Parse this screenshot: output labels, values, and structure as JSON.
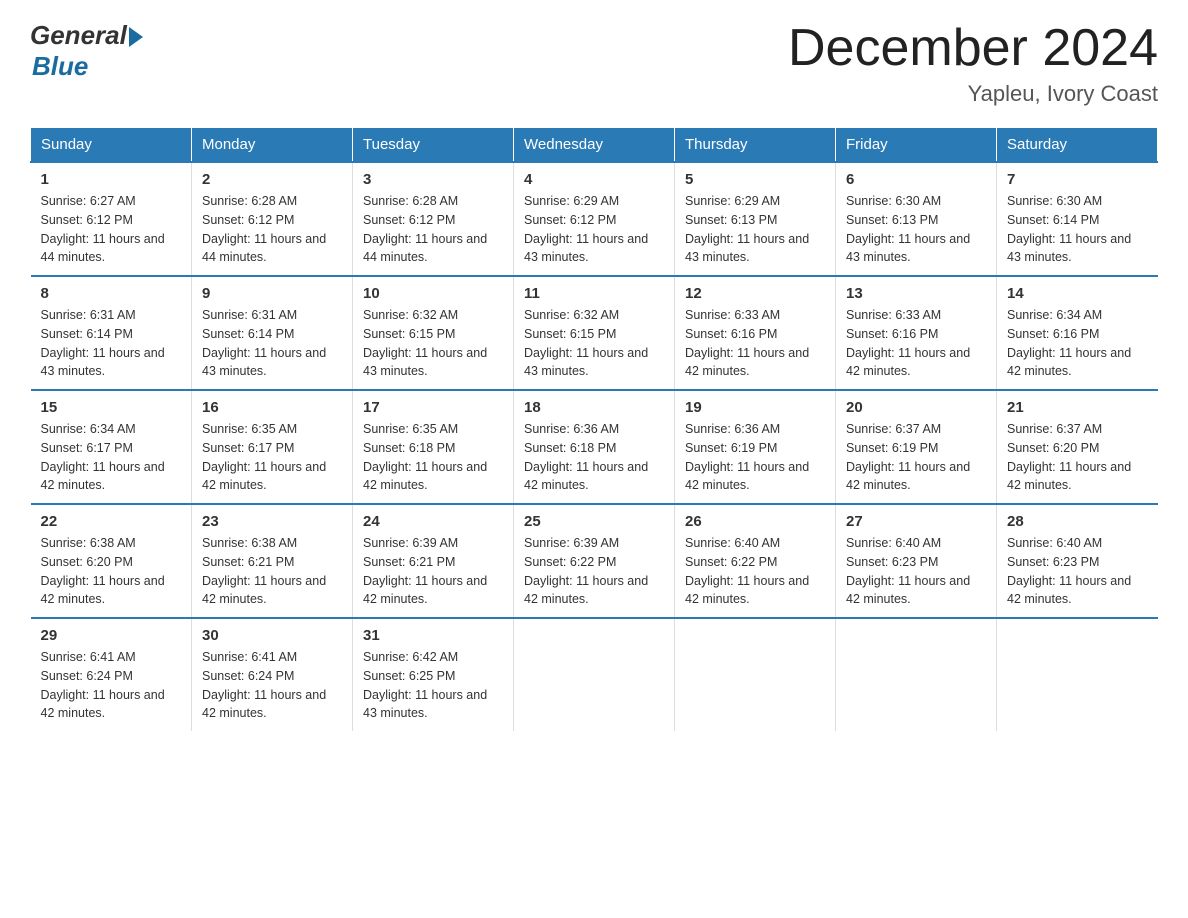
{
  "header": {
    "logo": {
      "general": "General",
      "blue": "Blue"
    },
    "title": "December 2024",
    "location": "Yapleu, Ivory Coast"
  },
  "days_of_week": [
    "Sunday",
    "Monday",
    "Tuesday",
    "Wednesday",
    "Thursday",
    "Friday",
    "Saturday"
  ],
  "weeks": [
    [
      {
        "day": "1",
        "sunrise": "6:27 AM",
        "sunset": "6:12 PM",
        "daylight": "11 hours and 44 minutes."
      },
      {
        "day": "2",
        "sunrise": "6:28 AM",
        "sunset": "6:12 PM",
        "daylight": "11 hours and 44 minutes."
      },
      {
        "day": "3",
        "sunrise": "6:28 AM",
        "sunset": "6:12 PM",
        "daylight": "11 hours and 44 minutes."
      },
      {
        "day": "4",
        "sunrise": "6:29 AM",
        "sunset": "6:12 PM",
        "daylight": "11 hours and 43 minutes."
      },
      {
        "day": "5",
        "sunrise": "6:29 AM",
        "sunset": "6:13 PM",
        "daylight": "11 hours and 43 minutes."
      },
      {
        "day": "6",
        "sunrise": "6:30 AM",
        "sunset": "6:13 PM",
        "daylight": "11 hours and 43 minutes."
      },
      {
        "day": "7",
        "sunrise": "6:30 AM",
        "sunset": "6:14 PM",
        "daylight": "11 hours and 43 minutes."
      }
    ],
    [
      {
        "day": "8",
        "sunrise": "6:31 AM",
        "sunset": "6:14 PM",
        "daylight": "11 hours and 43 minutes."
      },
      {
        "day": "9",
        "sunrise": "6:31 AM",
        "sunset": "6:14 PM",
        "daylight": "11 hours and 43 minutes."
      },
      {
        "day": "10",
        "sunrise": "6:32 AM",
        "sunset": "6:15 PM",
        "daylight": "11 hours and 43 minutes."
      },
      {
        "day": "11",
        "sunrise": "6:32 AM",
        "sunset": "6:15 PM",
        "daylight": "11 hours and 43 minutes."
      },
      {
        "day": "12",
        "sunrise": "6:33 AM",
        "sunset": "6:16 PM",
        "daylight": "11 hours and 42 minutes."
      },
      {
        "day": "13",
        "sunrise": "6:33 AM",
        "sunset": "6:16 PM",
        "daylight": "11 hours and 42 minutes."
      },
      {
        "day": "14",
        "sunrise": "6:34 AM",
        "sunset": "6:16 PM",
        "daylight": "11 hours and 42 minutes."
      }
    ],
    [
      {
        "day": "15",
        "sunrise": "6:34 AM",
        "sunset": "6:17 PM",
        "daylight": "11 hours and 42 minutes."
      },
      {
        "day": "16",
        "sunrise": "6:35 AM",
        "sunset": "6:17 PM",
        "daylight": "11 hours and 42 minutes."
      },
      {
        "day": "17",
        "sunrise": "6:35 AM",
        "sunset": "6:18 PM",
        "daylight": "11 hours and 42 minutes."
      },
      {
        "day": "18",
        "sunrise": "6:36 AM",
        "sunset": "6:18 PM",
        "daylight": "11 hours and 42 minutes."
      },
      {
        "day": "19",
        "sunrise": "6:36 AM",
        "sunset": "6:19 PM",
        "daylight": "11 hours and 42 minutes."
      },
      {
        "day": "20",
        "sunrise": "6:37 AM",
        "sunset": "6:19 PM",
        "daylight": "11 hours and 42 minutes."
      },
      {
        "day": "21",
        "sunrise": "6:37 AM",
        "sunset": "6:20 PM",
        "daylight": "11 hours and 42 minutes."
      }
    ],
    [
      {
        "day": "22",
        "sunrise": "6:38 AM",
        "sunset": "6:20 PM",
        "daylight": "11 hours and 42 minutes."
      },
      {
        "day": "23",
        "sunrise": "6:38 AM",
        "sunset": "6:21 PM",
        "daylight": "11 hours and 42 minutes."
      },
      {
        "day": "24",
        "sunrise": "6:39 AM",
        "sunset": "6:21 PM",
        "daylight": "11 hours and 42 minutes."
      },
      {
        "day": "25",
        "sunrise": "6:39 AM",
        "sunset": "6:22 PM",
        "daylight": "11 hours and 42 minutes."
      },
      {
        "day": "26",
        "sunrise": "6:40 AM",
        "sunset": "6:22 PM",
        "daylight": "11 hours and 42 minutes."
      },
      {
        "day": "27",
        "sunrise": "6:40 AM",
        "sunset": "6:23 PM",
        "daylight": "11 hours and 42 minutes."
      },
      {
        "day": "28",
        "sunrise": "6:40 AM",
        "sunset": "6:23 PM",
        "daylight": "11 hours and 42 minutes."
      }
    ],
    [
      {
        "day": "29",
        "sunrise": "6:41 AM",
        "sunset": "6:24 PM",
        "daylight": "11 hours and 42 minutes."
      },
      {
        "day": "30",
        "sunrise": "6:41 AM",
        "sunset": "6:24 PM",
        "daylight": "11 hours and 42 minutes."
      },
      {
        "day": "31",
        "sunrise": "6:42 AM",
        "sunset": "6:25 PM",
        "daylight": "11 hours and 43 minutes."
      },
      null,
      null,
      null,
      null
    ]
  ]
}
